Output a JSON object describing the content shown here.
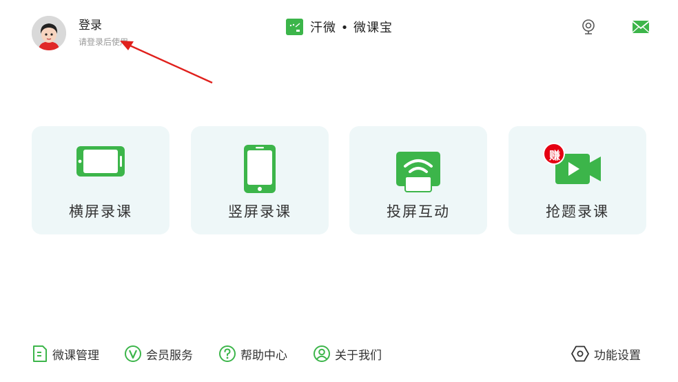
{
  "header": {
    "login_title": "登录",
    "login_hint": "请登录后使用",
    "brand_name": "汗微 • 微课宝",
    "avatar_icon": "boy-avatar-icon",
    "camera_icon": "webcam-icon",
    "mail_icon": "mail-icon"
  },
  "colors": {
    "accent": "#3cb54a",
    "card_bg": "#eef7f8",
    "badge": "#e50012",
    "arrow": "#e0201c"
  },
  "cards": [
    {
      "label": "横屏录课",
      "icon": "landscape-phone-icon"
    },
    {
      "label": "竖屏录课",
      "icon": "portrait-phone-icon"
    },
    {
      "label": "投屏互动",
      "icon": "screen-cast-icon"
    },
    {
      "label": "抢题录课",
      "icon": "video-camera-icon",
      "badge": "赚"
    }
  ],
  "footer": [
    {
      "label": "微课管理",
      "icon": "document-icon"
    },
    {
      "label": "会员服务",
      "icon": "vip-icon"
    },
    {
      "label": "帮助中心",
      "icon": "help-icon"
    },
    {
      "label": "关于我们",
      "icon": "user-icon"
    },
    {
      "label": "功能设置",
      "icon": "settings-icon"
    }
  ]
}
